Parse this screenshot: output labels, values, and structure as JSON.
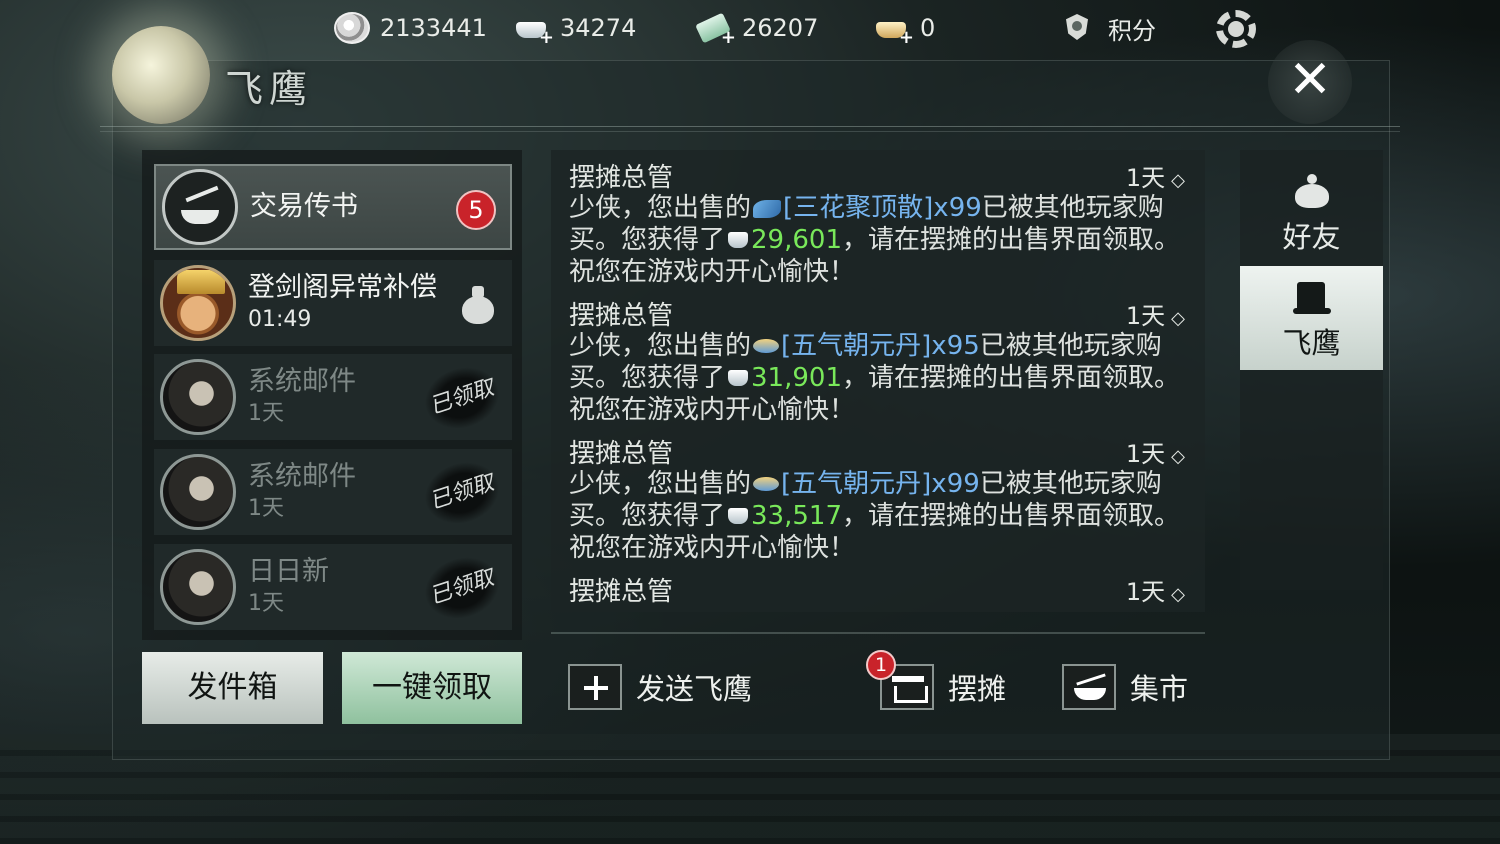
{
  "topbar": {
    "currencies": [
      {
        "icon": "coin-icon",
        "value": "2133441"
      },
      {
        "icon": "silver-ingot-icon",
        "value": "34274"
      },
      {
        "icon": "ticket-icon",
        "value": "26207"
      },
      {
        "icon": "gold-ingot-icon",
        "value": "0"
      }
    ],
    "points_label": "积分",
    "points_icon": "shield-icon",
    "settings_icon": "gear-icon"
  },
  "panel": {
    "title": "飞鹰",
    "close_label": "✕"
  },
  "mail_list": [
    {
      "name": "交易传书",
      "sub": "",
      "avatar": "scale-icon",
      "badge": "5",
      "state": "active"
    },
    {
      "name": "登剑阁异常补偿",
      "sub": "01:49",
      "avatar": "official-portrait",
      "attachment_icon": "money-bag-icon",
      "state": "unread"
    },
    {
      "name": "系统邮件",
      "sub": "1天",
      "avatar": "hermit-portrait",
      "stamp": "已领取",
      "state": "read"
    },
    {
      "name": "系统邮件",
      "sub": "1天",
      "avatar": "hermit-portrait",
      "stamp": "已领取",
      "state": "read"
    },
    {
      "name": "日日新",
      "sub": "1天",
      "avatar": "hermit-portrait",
      "stamp": "已领取",
      "state": "read"
    }
  ],
  "left_buttons": {
    "outbox": "发件箱",
    "claim_all": "一键领取"
  },
  "messages": [
    {
      "sender": "摆摊总管",
      "time": "1天",
      "prefix": "少侠，您出售的",
      "item": "[三花聚顶散]x99",
      "mid": "已被其他玩家购买。您获得了",
      "amount": "29,601",
      "suffix": "，请在摆摊的出售界面领取。祝您在游戏内开心愉快！"
    },
    {
      "sender": "摆摊总管",
      "time": "1天",
      "prefix": "少侠，您出售的",
      "item": "[五气朝元丹]x95",
      "mid": "已被其他玩家购买。您获得了",
      "amount": "31,901",
      "suffix": "，请在摆摊的出售界面领取。祝您在游戏内开心愉快！"
    },
    {
      "sender": "摆摊总管",
      "time": "1天",
      "prefix": "少侠，您出售的",
      "item": "[五气朝元丹]x99",
      "mid": "已被其他玩家购买。您获得了",
      "amount": "33,517",
      "suffix": "，请在摆摊的出售界面领取。祝您在游戏内开心愉快！"
    },
    {
      "sender": "摆摊总管",
      "time": "1天"
    }
  ],
  "time_marker": "◇",
  "actions": {
    "send": "发送飞鹰",
    "stall": "摆摊",
    "stall_badge": "1",
    "market": "集市"
  },
  "side_tabs": [
    {
      "label": "好友",
      "icon": "teapot-icon"
    },
    {
      "label": "飞鹰",
      "icon": "scroll-icon",
      "active": true
    }
  ],
  "colors": {
    "item_link": "#76b4ee",
    "amount": "#79e85a",
    "badge": "#c9232a"
  }
}
